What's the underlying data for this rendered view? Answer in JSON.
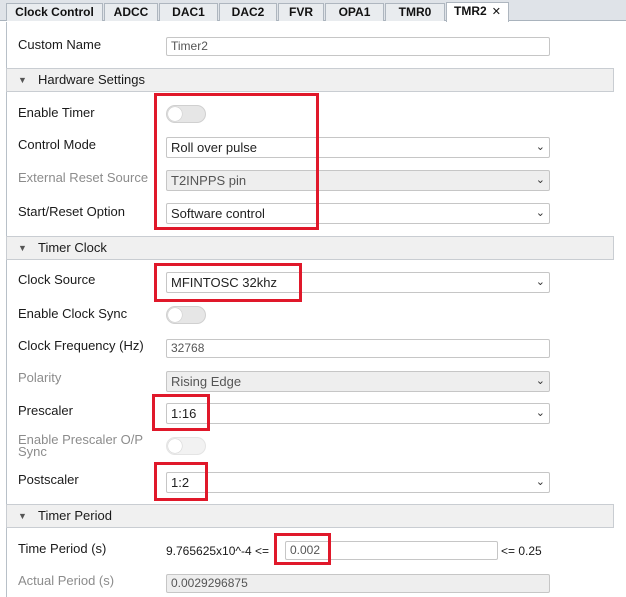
{
  "tabs": [
    {
      "label": "Clock Control",
      "active": false
    },
    {
      "label": "ADCC",
      "active": false
    },
    {
      "label": "DAC1",
      "active": false
    },
    {
      "label": "DAC2",
      "active": false
    },
    {
      "label": "FVR",
      "active": false
    },
    {
      "label": "OPA1",
      "active": false
    },
    {
      "label": "TMR0",
      "active": false
    },
    {
      "label": "TMR2",
      "active": true,
      "closable": true
    }
  ],
  "custom_name": {
    "label": "Custom Name",
    "value": "Timer2"
  },
  "hardware": {
    "title": "Hardware Settings",
    "enable_timer": {
      "label": "Enable Timer",
      "on": false
    },
    "control_mode": {
      "label": "Control Mode",
      "value": "Roll over pulse"
    },
    "external_reset": {
      "label": "External Reset Source",
      "value": "T2INPPS pin",
      "disabled": true
    },
    "start_reset": {
      "label": "Start/Reset Option",
      "value": "Software control"
    }
  },
  "clock": {
    "title": "Timer Clock",
    "clock_source": {
      "label": "Clock Source",
      "value": "MFINTOSC 32khz"
    },
    "enable_sync": {
      "label": "Enable Clock Sync",
      "on": false
    },
    "frequency": {
      "label": "Clock Frequency (Hz)",
      "value": "32768"
    },
    "polarity": {
      "label": "Polarity",
      "value": "Rising Edge",
      "disabled": true
    },
    "prescaler": {
      "label": "Prescaler",
      "value": "1:16"
    },
    "prescaler_op_sync": {
      "label_line1": "Enable Prescaler O/P",
      "label_line2": "Sync",
      "disabled": true
    },
    "postscaler": {
      "label": "Postscaler",
      "value": "1:2"
    }
  },
  "period": {
    "title": "Timer Period",
    "time_period": {
      "label": "Time Period (s)",
      "min": "9.765625x10^-4",
      "min_op": "<=",
      "value": "0.002",
      "max_text": "<= 0.25"
    },
    "actual_period": {
      "label": "Actual Period (s)",
      "value": "0.0029296875"
    }
  },
  "colors": {
    "highlight": "#e0182a",
    "section_bg": "#f0f0f0",
    "tab_bg": "#dfe3e8"
  },
  "icons": {
    "collapse": "triangle-down",
    "dropdown": "chevron-down",
    "tab_close": "x"
  }
}
